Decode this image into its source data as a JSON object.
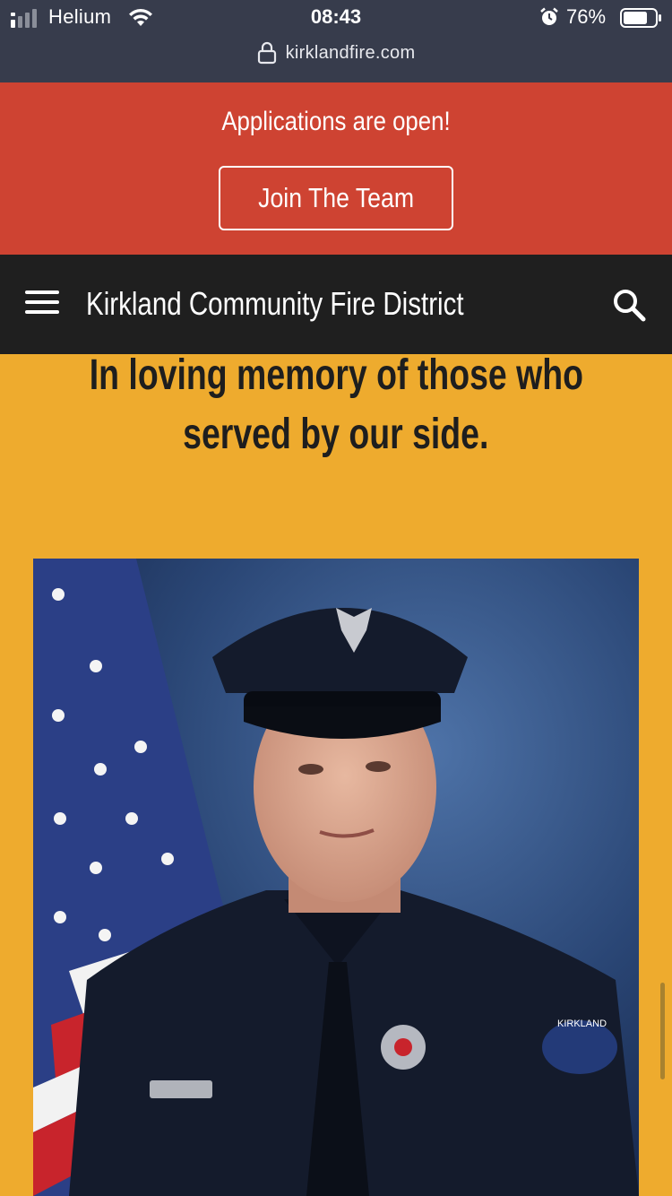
{
  "status_bar": {
    "carrier": "Helium",
    "time": "08:43",
    "battery": "76%",
    "battery_level": 0.76
  },
  "browser": {
    "url": "kirklandfire.com"
  },
  "announcement": {
    "text": "Applications are open!",
    "button_label": "Join The Team",
    "background_color": "#CE4332"
  },
  "navbar": {
    "site_title": "Kirkland Community Fire District",
    "background_color": "#1F1F1F"
  },
  "memorial": {
    "heading_line1": "In loving memory of those who",
    "heading_line2": "served by our side.",
    "background_color": "#EEAB2E",
    "portrait": {
      "alt": "Firefighter in dress uniform portrait with American flag",
      "name_tag": "",
      "patch_text": "KIRKLAND"
    }
  },
  "icons": [
    "signal-icon",
    "wifi-icon",
    "alarm-icon",
    "battery-icon",
    "lock-icon",
    "menu-icon",
    "search-icon"
  ]
}
